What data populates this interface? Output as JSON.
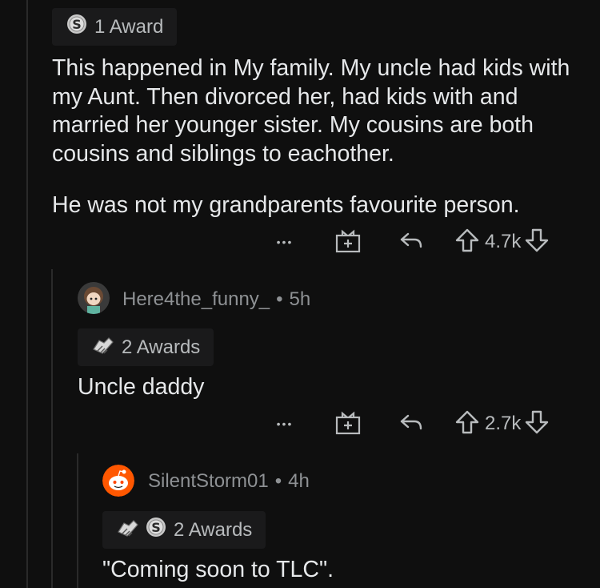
{
  "comments": [
    {
      "awards_label": "1 Award",
      "paragraphs": [
        "This happened in My family. My uncle had kids with my Aunt. Then divorced her, had kids with and married her younger sister. My cousins are both cousins and siblings to eachother.",
        "He was not my grandparents favourite person."
      ],
      "score": "4.7k",
      "more_label": "•••",
      "icons": [
        "silver-award-icon",
        "more-icon",
        "gift-icon",
        "reply-icon",
        "upvote-icon",
        "downvote-icon"
      ]
    },
    {
      "author": "Here4the_funny_",
      "separator": "•",
      "age": "5h",
      "awards_label": "2 Awards",
      "paragraphs": [
        "Uncle daddy"
      ],
      "score": "2.7k",
      "more_label": "•••",
      "icons": [
        "handshake-award-icon",
        "more-icon",
        "gift-icon",
        "reply-icon",
        "upvote-icon",
        "downvote-icon"
      ]
    },
    {
      "author": "SilentStorm01",
      "separator": "•",
      "age": "4h",
      "awards_label": "2 Awards",
      "paragraphs": [
        "\"Coming soon to TLC\"."
      ],
      "icons": [
        "handshake-award-icon",
        "silver-award-icon"
      ]
    }
  ],
  "colors": {
    "background": "#0f0f0f",
    "text": "#e6e8ea",
    "muted": "#8e9194",
    "pill": "#1a1a1b",
    "thread_line": "#2a2a2a",
    "snoo_orange": "#ff5700"
  }
}
